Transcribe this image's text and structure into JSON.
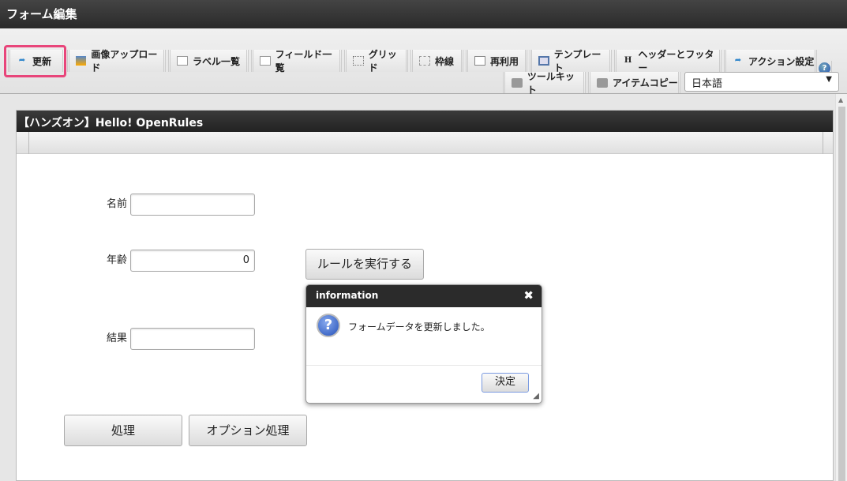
{
  "window_title": "フォーム編集",
  "toolbar": {
    "tabs": [
      {
        "label": "更新",
        "icon": "update-icon"
      },
      {
        "label": "画像アップロード",
        "icon": "image-upload-icon"
      },
      {
        "label": "ラベル一覧",
        "icon": "list-icon"
      },
      {
        "label": "フィールド一覧",
        "icon": "list-icon"
      },
      {
        "label": "グリッド",
        "icon": "grid-icon"
      },
      {
        "label": "枠線",
        "icon": "frame-icon"
      },
      {
        "label": "再利用",
        "icon": "copy-icon"
      },
      {
        "label": "テンプレート",
        "icon": "template-icon"
      },
      {
        "label": "ヘッダーとフッター",
        "icon": "header-icon",
        "glyph": "H"
      },
      {
        "label": "アクション設定",
        "icon": "action-icon"
      },
      {
        "label": "ツールキット",
        "icon": "toolbox-icon"
      },
      {
        "label": "アイテムコピー",
        "icon": "toolbox-icon"
      }
    ],
    "language": "日本語",
    "help": "?"
  },
  "form": {
    "title": "【ハンズオン】Hello! OpenRules",
    "name_label": "名前",
    "name_value": "",
    "age_label": "年齢",
    "age_value": "0",
    "result_label": "結果",
    "result_value": "",
    "run_button": "ルールを実行する",
    "process_button": "処理",
    "option_button": "オプション処理"
  },
  "dialog": {
    "title": "information",
    "close": "✖",
    "message": "フォームデータを更新しました。",
    "ok": "決定",
    "icon_glyph": "?"
  }
}
